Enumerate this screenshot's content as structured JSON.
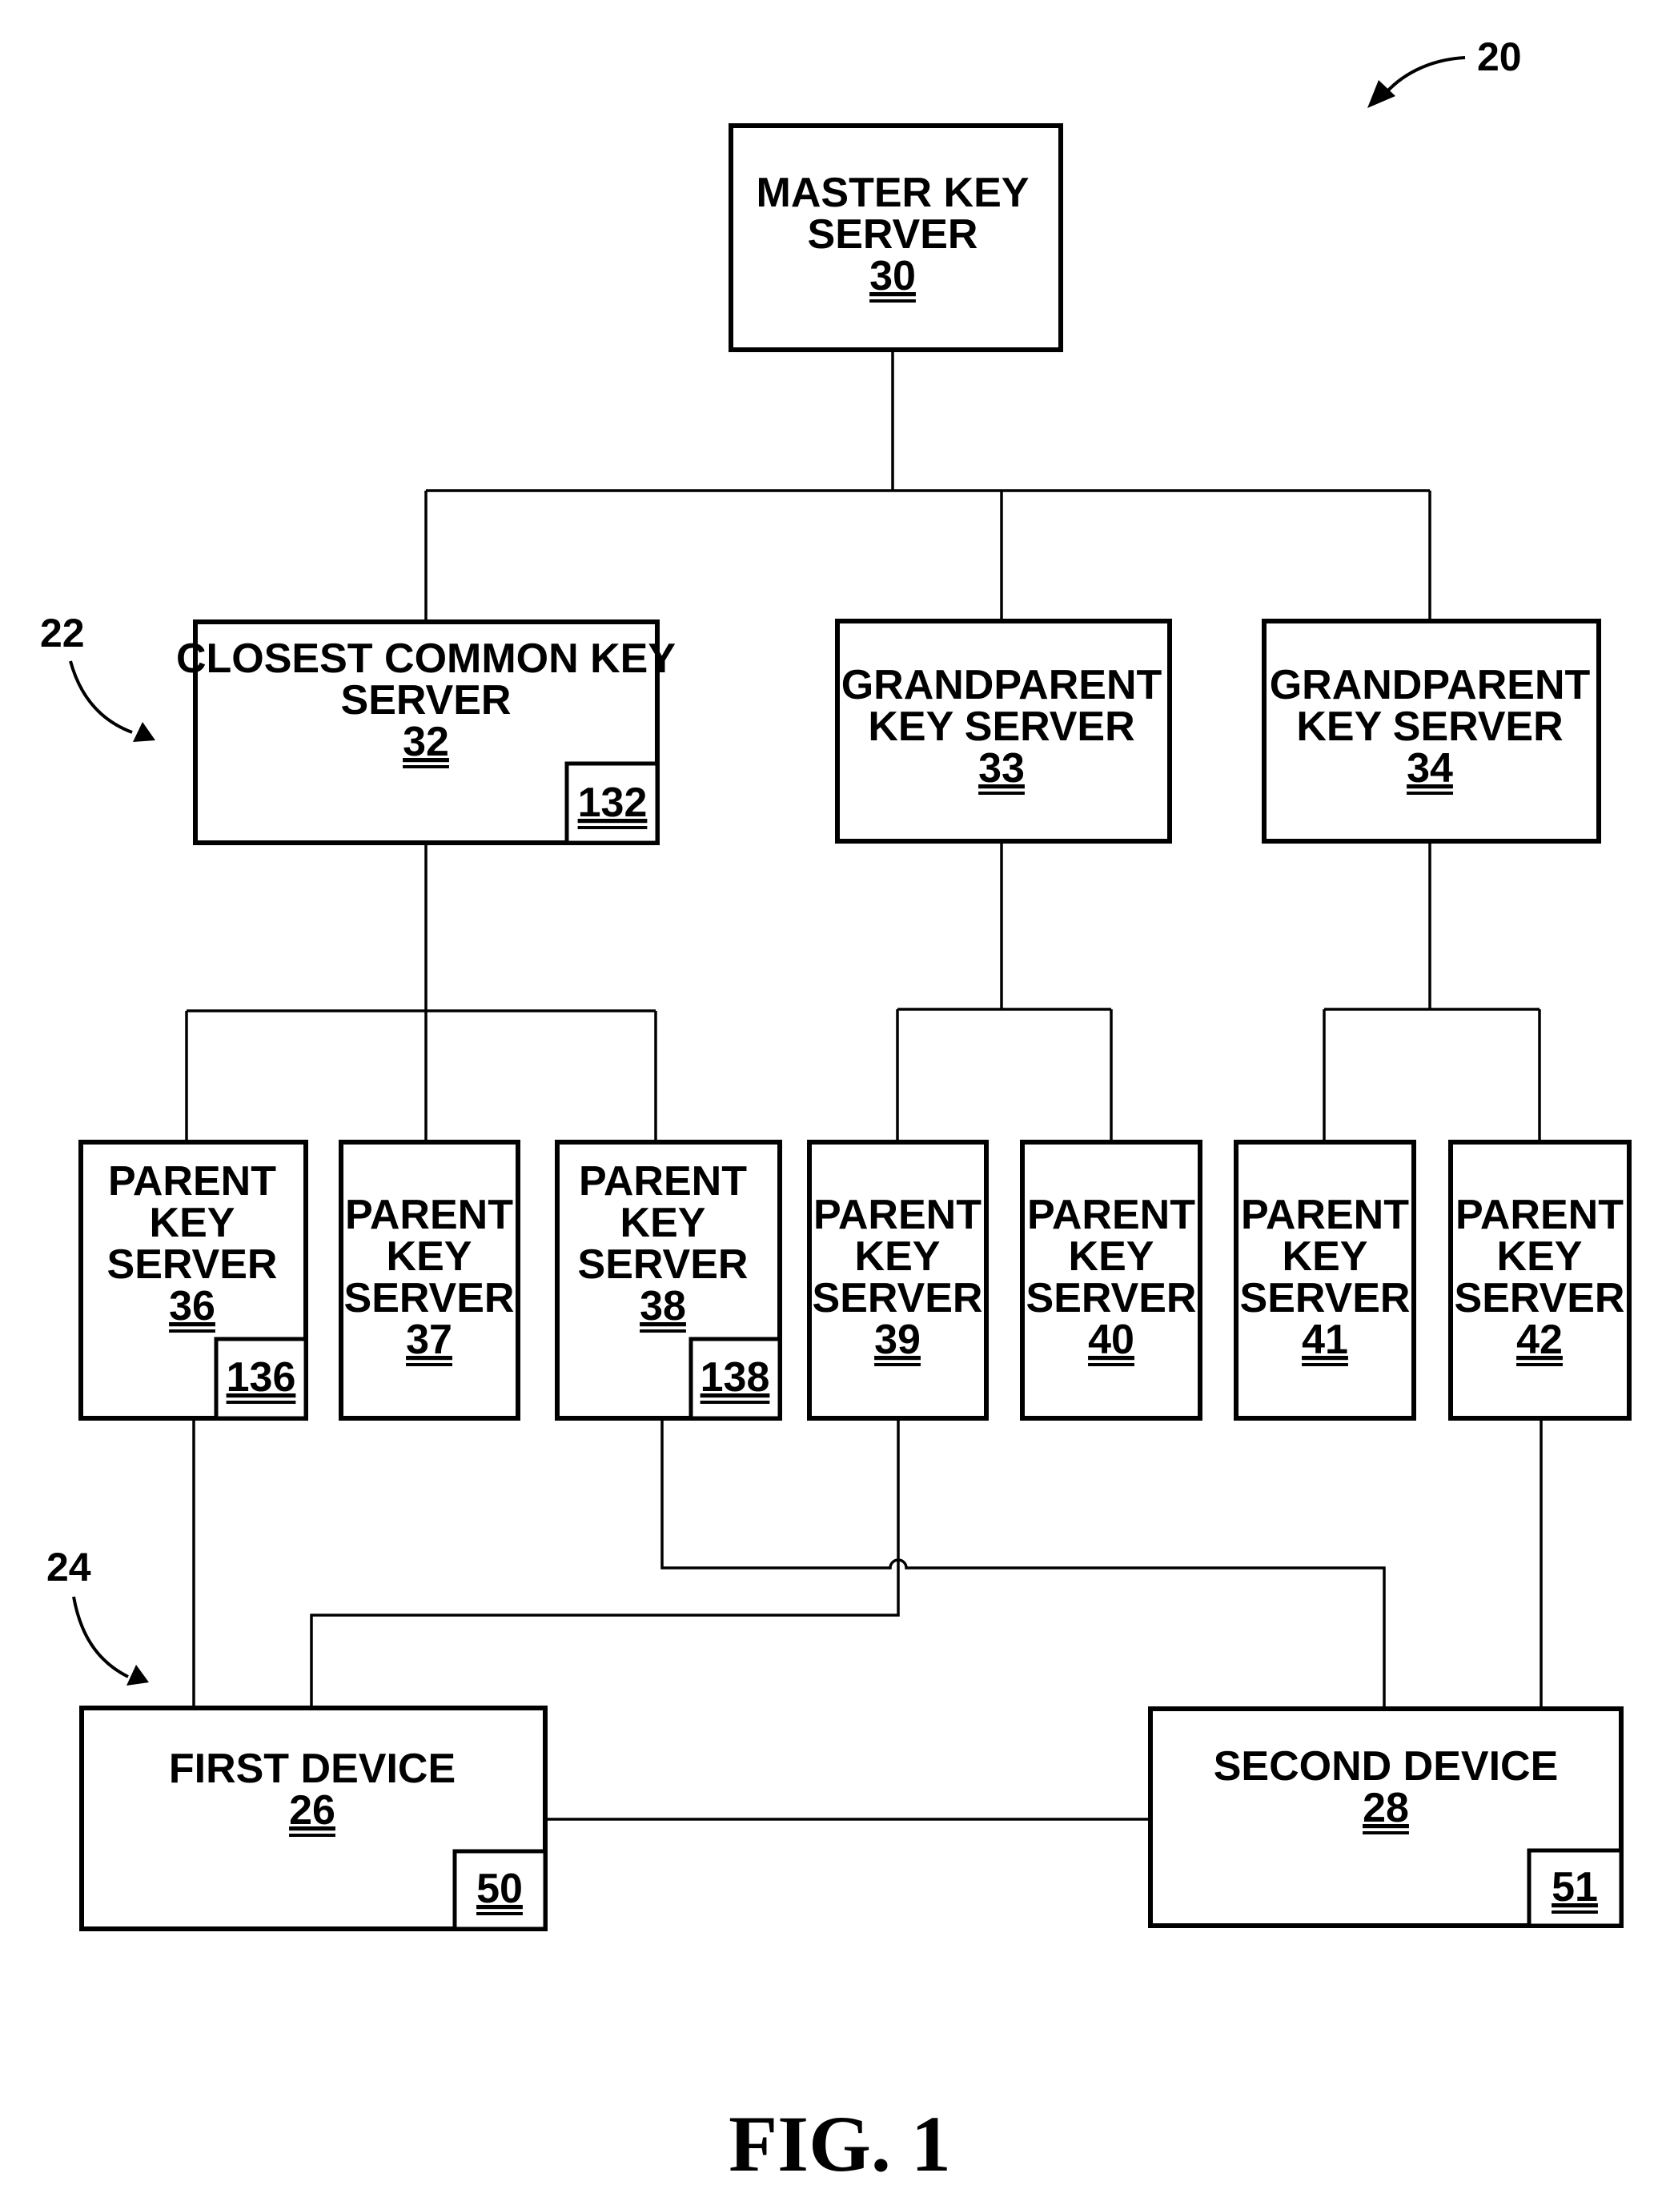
{
  "figure": {
    "caption": "FIG. 1",
    "system_ref": "20",
    "group_refs": {
      "key_server_group": "22",
      "device_group": "24"
    }
  },
  "nodes": {
    "master": {
      "lines": [
        "MASTER KEY",
        "SERVER"
      ],
      "ref": "30"
    },
    "closest_common": {
      "lines": [
        "CLOSEST COMMON KEY",
        "SERVER"
      ],
      "ref": "32",
      "sub_ref": "132"
    },
    "grandparent_33": {
      "lines": [
        "GRANDPARENT",
        "KEY SERVER"
      ],
      "ref": "33"
    },
    "grandparent_34": {
      "lines": [
        "GRANDPARENT",
        "KEY SERVER"
      ],
      "ref": "34"
    },
    "parent_36": {
      "lines": [
        "PARENT",
        "KEY",
        "SERVER"
      ],
      "ref": "36",
      "sub_ref": "136"
    },
    "parent_37": {
      "lines": [
        "PARENT",
        "KEY",
        "SERVER"
      ],
      "ref": "37"
    },
    "parent_38": {
      "lines": [
        "PARENT",
        "KEY",
        "SERVER"
      ],
      "ref": "38",
      "sub_ref": "138"
    },
    "parent_39": {
      "lines": [
        "PARENT",
        "KEY",
        "SERVER"
      ],
      "ref": "39"
    },
    "parent_40": {
      "lines": [
        "PARENT",
        "KEY",
        "SERVER"
      ],
      "ref": "40"
    },
    "parent_41": {
      "lines": [
        "PARENT",
        "KEY",
        "SERVER"
      ],
      "ref": "41"
    },
    "parent_42": {
      "lines": [
        "PARENT",
        "KEY",
        "SERVER"
      ],
      "ref": "42"
    },
    "first_device": {
      "lines": [
        "FIRST DEVICE"
      ],
      "ref": "26",
      "sub_ref": "50"
    },
    "second_device": {
      "lines": [
        "SECOND DEVICE"
      ],
      "ref": "28",
      "sub_ref": "51"
    }
  },
  "edges": [
    [
      "master",
      "closest_common"
    ],
    [
      "master",
      "grandparent_33"
    ],
    [
      "master",
      "grandparent_34"
    ],
    [
      "closest_common",
      "parent_36"
    ],
    [
      "closest_common",
      "parent_37"
    ],
    [
      "closest_common",
      "parent_38"
    ],
    [
      "grandparent_33",
      "parent_39"
    ],
    [
      "grandparent_33",
      "parent_40"
    ],
    [
      "grandparent_34",
      "parent_41"
    ],
    [
      "grandparent_34",
      "parent_42"
    ],
    [
      "parent_36",
      "first_device"
    ],
    [
      "parent_39",
      "first_device"
    ],
    [
      "parent_38",
      "second_device"
    ],
    [
      "parent_42",
      "second_device"
    ],
    [
      "first_device",
      "second_device"
    ]
  ]
}
